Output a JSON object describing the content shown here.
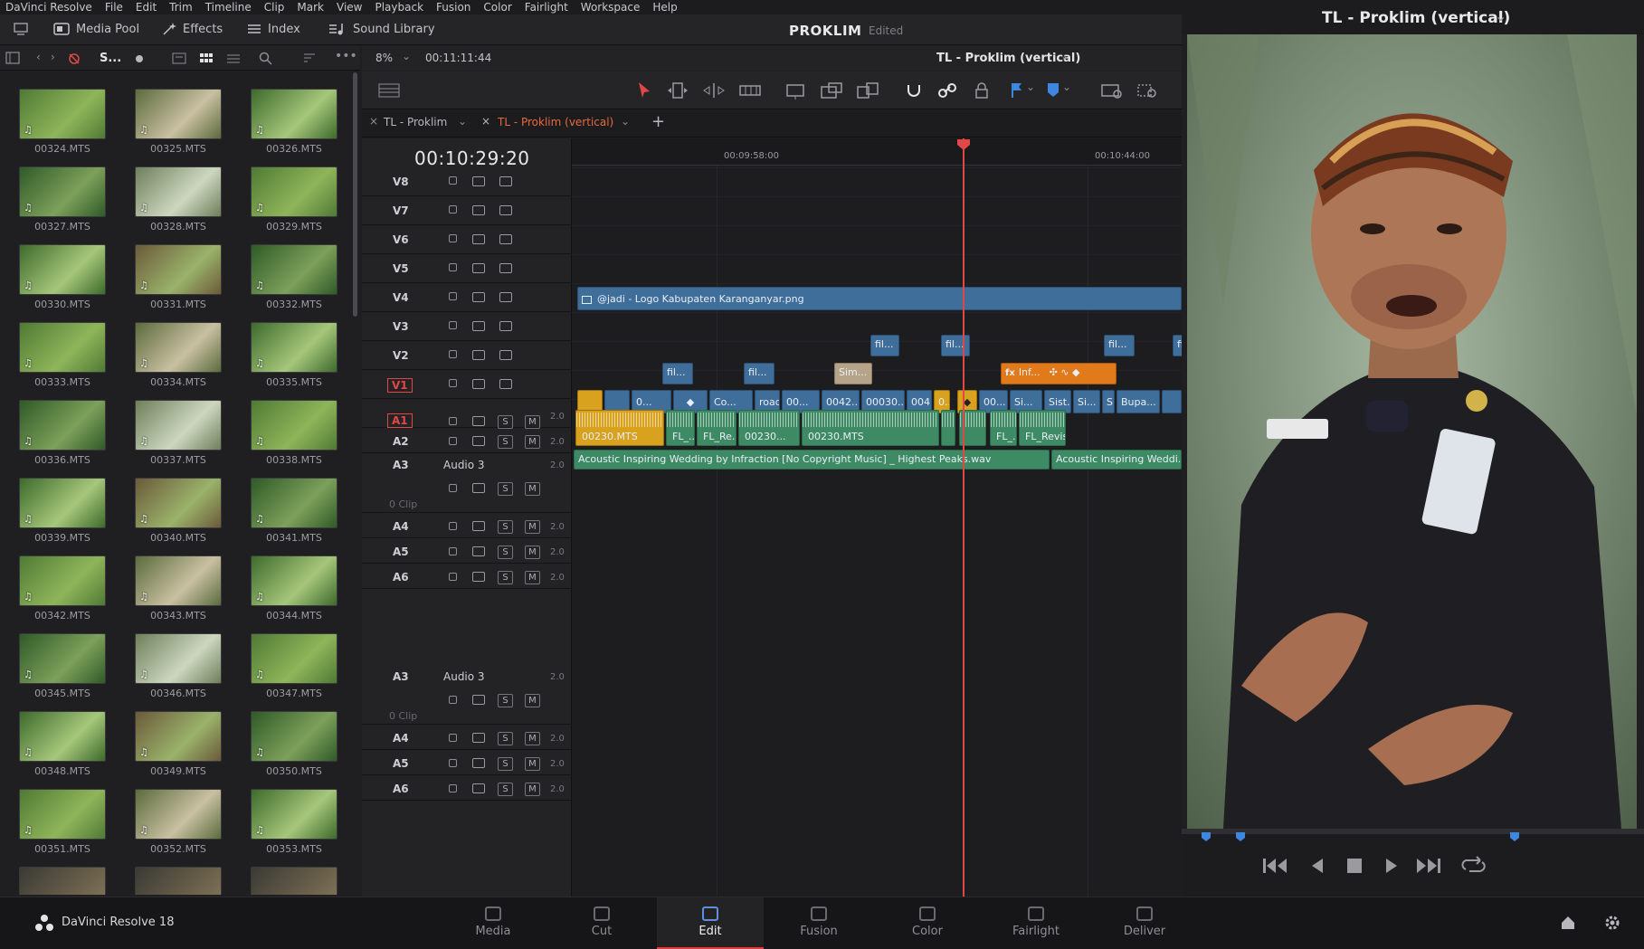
{
  "menu": [
    "DaVinci Resolve",
    "File",
    "Edit",
    "Trim",
    "Timeline",
    "Clip",
    "Mark",
    "View",
    "Playback",
    "Fusion",
    "Color",
    "Fairlight",
    "Workspace",
    "Help"
  ],
  "toolbar": {
    "media_pool": "Media Pool",
    "effects": "Effects",
    "index": "Index",
    "sound_library": "Sound Library",
    "project_name": "PROKLIM",
    "project_status": "Edited",
    "viewer_title_top": "TL - Proklim (vertical)"
  },
  "mediapool": {
    "filter_label": "S...",
    "clips": [
      "00324.MTS",
      "00325.MTS",
      "00326.MTS",
      "00327.MTS",
      "00328.MTS",
      "00329.MTS",
      "00330.MTS",
      "00331.MTS",
      "00332.MTS",
      "00333.MTS",
      "00334.MTS",
      "00335.MTS",
      "00336.MTS",
      "00337.MTS",
      "00338.MTS",
      "00339.MTS",
      "00340.MTS",
      "00341.MTS",
      "00342.MTS",
      "00343.MTS",
      "00344.MTS",
      "00345.MTS",
      "00346.MTS",
      "00347.MTS",
      "00348.MTS",
      "00349.MTS",
      "00350.MTS",
      "00351.MTS",
      "00352.MTS",
      "00353.MTS"
    ]
  },
  "timeline": {
    "zoom": "8%",
    "duration": "00:11:11:44",
    "tabs": [
      {
        "label": "TL - Proklim",
        "active": false
      },
      {
        "label": "TL - Proklim (vertical)",
        "active": true
      }
    ],
    "timecode": "00:10:29:20",
    "ruler": [
      "00:09:58:00",
      "00:10:44:00"
    ],
    "video_tracks": [
      "V8",
      "V7",
      "V6",
      "V5",
      "V4",
      "V3",
      "V2",
      "V1"
    ],
    "audio_tracks": [
      {
        "name": "A1",
        "ch": "2.0"
      },
      {
        "name": "A2",
        "ch": "2.0"
      },
      {
        "name": "A3",
        "ch": "2.0",
        "title": "Audio 3",
        "empty": "0 Clip"
      },
      {
        "name": "A4",
        "ch": "2.0"
      },
      {
        "name": "A5",
        "ch": "2.0"
      },
      {
        "name": "A6",
        "ch": "2.0"
      }
    ],
    "audio_tracks_lower": [
      {
        "name": "A3",
        "ch": "2.0",
        "title": "Audio 3",
        "empty": "0 Clip"
      },
      {
        "name": "A4",
        "ch": "2.0"
      },
      {
        "name": "A5",
        "ch": "2.0"
      },
      {
        "name": "A6",
        "ch": "2.0"
      }
    ],
    "clips": {
      "v5": "@jadi - Logo Kabupaten Karanganyar.png",
      "v3": [
        "fil...",
        "fil...",
        "fil...",
        "fil."
      ],
      "v2": [
        "fil...",
        "fil...",
        "Sim...",
        "Inf..."
      ],
      "v1": [
        "0...",
        "Co...",
        "road...",
        "00...",
        "0042...",
        "00030...",
        "00410...",
        "0...",
        "00...",
        "Si...",
        "Sist...",
        "Si...",
        "Si...",
        "Bupa..."
      ],
      "a1": [
        "00230.MTS",
        "FL_...",
        "FL_Re...",
        "00230...",
        "00230.MTS",
        "FL_...",
        "FL_Revisi ..."
      ],
      "a2": [
        "Acoustic Inspiring Wedding by Infraction [No Copyright Music] _ Highest Peaks.wav",
        "Acoustic Inspiring Weddi..."
      ]
    }
  },
  "viewer": {
    "title": "TL - Proklim (vertical)"
  },
  "footer": {
    "app": "DaVinci Resolve 18",
    "pages": [
      "Media",
      "Cut",
      "Edit",
      "Fusion",
      "Color",
      "Fairlight",
      "Deliver"
    ],
    "active_page": "Edit"
  },
  "colors": {
    "accent_red": "#e04848",
    "video_clip": "#3f6e9a",
    "audio_clip": "#3d8a64",
    "adjust_clip": "#e07a1a",
    "yellow_clip": "#d9a21e"
  }
}
